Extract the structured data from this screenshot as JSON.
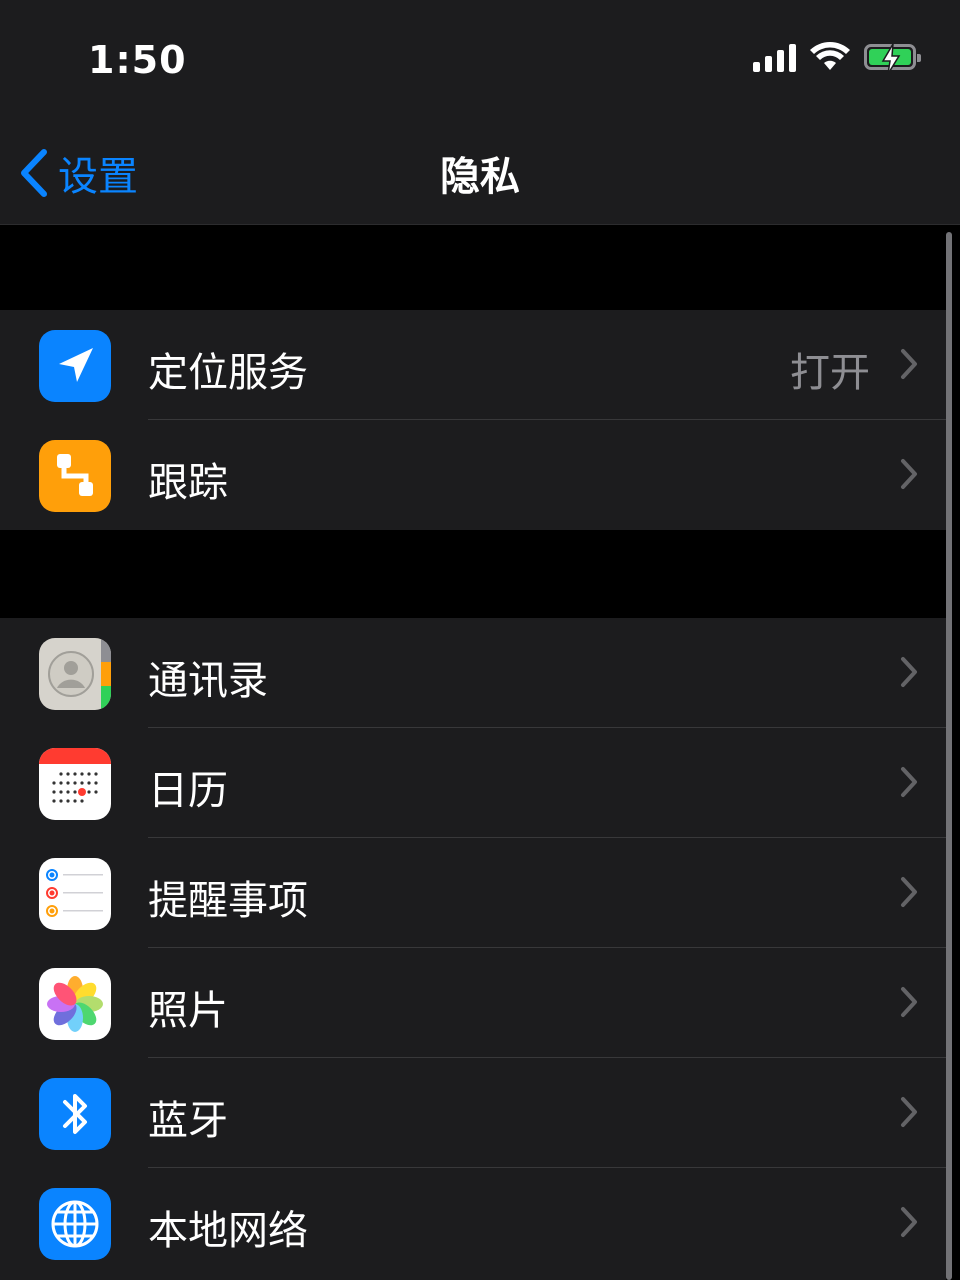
{
  "status": {
    "time": "1:50"
  },
  "nav": {
    "back_label": "设置",
    "title": "隐私"
  },
  "groups": {
    "first": [
      {
        "label": "定位服务",
        "value": "打开",
        "icon": "location-arrow-icon",
        "color": "#0a84ff"
      },
      {
        "label": "跟踪",
        "value": "",
        "icon": "tracking-icon",
        "color": "#ff9f0a"
      }
    ],
    "second": [
      {
        "label": "通讯录",
        "icon": "contacts-icon"
      },
      {
        "label": "日历",
        "icon": "calendar-icon"
      },
      {
        "label": "提醒事项",
        "icon": "reminders-icon"
      },
      {
        "label": "照片",
        "icon": "photos-icon"
      },
      {
        "label": "蓝牙",
        "icon": "bluetooth-icon",
        "color": "#0a84ff"
      },
      {
        "label": "本地网络",
        "icon": "globe-icon",
        "color": "#0a84ff"
      }
    ]
  },
  "colors": {
    "accent": "#0a84ff",
    "background": "#000000",
    "cell": "#1c1c1e"
  }
}
